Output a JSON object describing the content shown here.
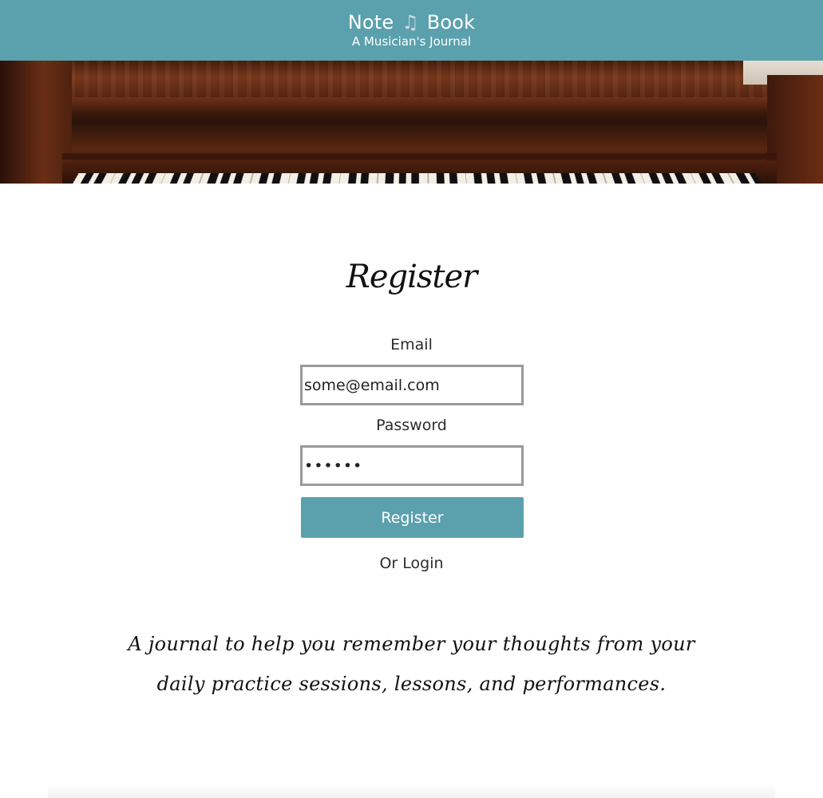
{
  "header": {
    "title_part1": "Note",
    "title_icon": "music-note-icon",
    "title_part2": "Book",
    "subtitle": "A Musician's Journal"
  },
  "form": {
    "heading": "Register",
    "email_label": "Email",
    "email_value": "some@email.com",
    "password_label": "Password",
    "password_value": "••••••",
    "submit_label": "Register",
    "alt_link": "Or Login"
  },
  "tagline": "A journal to help you remember your thoughts from your daily practice sessions, lessons, and performances.",
  "colors": {
    "header_bg": "#5ba1ad",
    "button_bg": "#5ba1ad",
    "input_border": "#9a9a9a"
  }
}
